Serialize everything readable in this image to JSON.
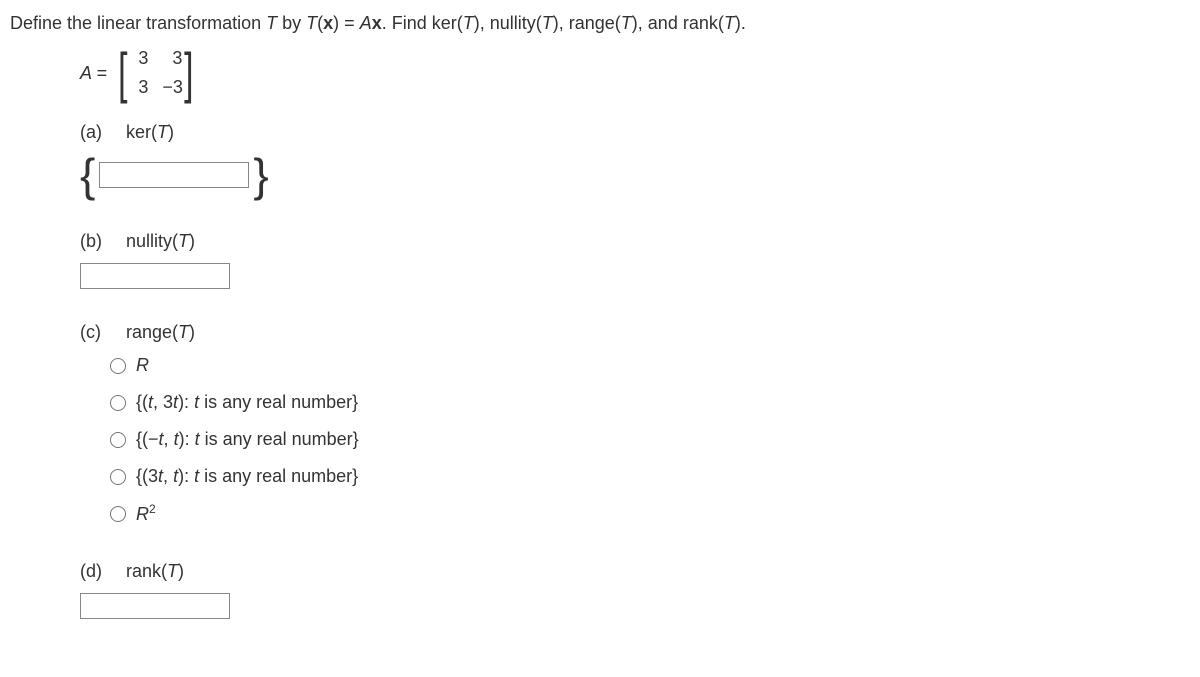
{
  "prompt": {
    "pre": "Define the linear transformation ",
    "T": "T",
    "by": " by ",
    "Tx": "T",
    "paren_x_pre": "(",
    "x": "x",
    "paren_x_post": ") = ",
    "Ax_A": "A",
    "Ax_x": "x",
    "post": ". Find ker(",
    "T2": "T",
    "post2": "), nullity(",
    "T3": "T",
    "post3": "), range(",
    "T4": "T",
    "post4": "), and rank(",
    "T5": "T",
    "post5": ")."
  },
  "matrix": {
    "lhs": "A = ",
    "r1c1": "3",
    "r1c2": "3",
    "r2c1": "3",
    "r2c2": "−3"
  },
  "parts": {
    "a": {
      "letter": "(a)",
      "label_pre": "ker(",
      "label_T": "T",
      "label_post": ")"
    },
    "b": {
      "letter": "(b)",
      "label_pre": "nullity(",
      "label_T": "T",
      "label_post": ")"
    },
    "c": {
      "letter": "(c)",
      "label_pre": "range(",
      "label_T": "T",
      "label_post": ")"
    },
    "d": {
      "letter": "(d)",
      "label_pre": "rank(",
      "label_T": "T",
      "label_post": ")"
    }
  },
  "options_c": {
    "o1": "R",
    "o2_pre": "{(",
    "o2_t1": "t",
    "o2_mid1": ", 3",
    "o2_t2": "t",
    "o2_mid2": "): ",
    "o2_t3": "t",
    "o2_post": " is any real number}",
    "o3_pre": "{(−",
    "o3_t1": "t",
    "o3_mid1": ", ",
    "o3_t2": "t",
    "o3_mid2": "): ",
    "o3_t3": "t",
    "o3_post": " is any real number}",
    "o4_pre": "{(3",
    "o4_t1": "t",
    "o4_mid1": ", ",
    "o4_t2": "t",
    "o4_mid2": "): ",
    "o4_t3": "t",
    "o4_post": " is any real number}",
    "o5_R": "R",
    "o5_sup": "2"
  }
}
